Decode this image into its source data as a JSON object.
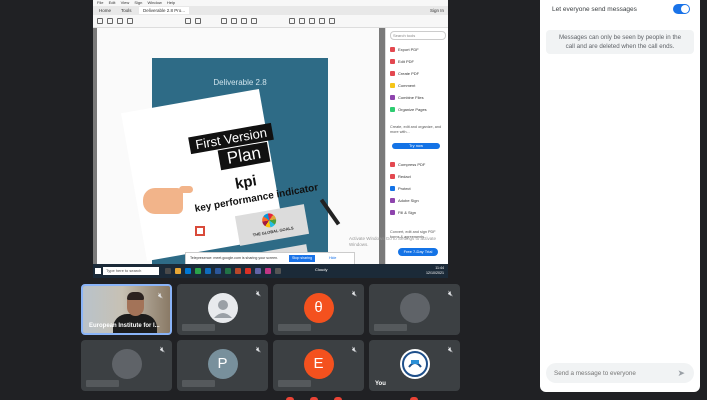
{
  "shared_screen": {
    "menu": [
      "File",
      "Edit",
      "View",
      "Sign",
      "Window",
      "Help"
    ],
    "tabs": [
      "Home",
      "Tools",
      "Deliverable 2.8 Pro..."
    ],
    "sign_in": "Sign In",
    "document": {
      "deliverable": "Deliverable 2.8",
      "first_version": "First Version",
      "plan": "Plan",
      "kpi": "kpi",
      "kpi_full": "key performance indicator",
      "sdg_label": "THE GLOBAL GOALS"
    },
    "tools_pane": {
      "search_placeholder": "Search tools",
      "items": [
        "Export PDF",
        "Edit PDF",
        "Create PDF",
        "Comment",
        "Combine Files",
        "Organize Pages"
      ],
      "promo": "Create, edit and organize, and more with...",
      "try_now": "Try now",
      "items2": [
        "Compress PDF",
        "Redact",
        "Protect",
        "Adobe Sign",
        "Fill & Sign"
      ],
      "promo2": "Convert, edit and sign PDF forms & agreements",
      "free_trial": "Free 7-Day Trial"
    },
    "notification": {
      "text": "Telepresence: meet.google.com is sharing your screen.",
      "primary": "Stop sharing",
      "secondary": "Hide"
    },
    "activate": "Activate Windows\nGo to Settings to activate Windows.",
    "taskbar": {
      "search": "Type here to search",
      "weather": "Cloudy",
      "time": "11:44",
      "date": "12/10/2021"
    }
  },
  "participants": [
    {
      "name": "European Institute for I...",
      "mic": "muted",
      "type": "video"
    },
    {
      "name": "",
      "mic": "muted",
      "type": "placeholder"
    },
    {
      "name": "",
      "mic": "muted",
      "type": "avatar",
      "initial": "θ",
      "color": "#f4511e"
    },
    {
      "name": "",
      "mic": "muted",
      "type": "placeholder"
    },
    {
      "name": "",
      "mic": "muted",
      "type": "placeholder"
    },
    {
      "name": "",
      "mic": "muted",
      "type": "avatar",
      "initial": "P",
      "color": "#78909c"
    },
    {
      "name": "",
      "mic": "muted",
      "type": "avatar",
      "initial": "E",
      "color": "#f4511e"
    },
    {
      "name": "You",
      "mic": "muted",
      "type": "logo"
    }
  ],
  "chat": {
    "let_everyone": "Let everyone send messages",
    "toggle_on": true,
    "info": "Messages can only be seen by people in the call and are deleted when the call ends.",
    "input_placeholder": "Send a message to everyone"
  },
  "colors": {
    "background": "#202124",
    "tile": "#3c4043",
    "accent": "#1a73e8"
  },
  "icons": {
    "mic_off": "mic-off-icon",
    "send": "send-icon",
    "person": "person-icon"
  }
}
